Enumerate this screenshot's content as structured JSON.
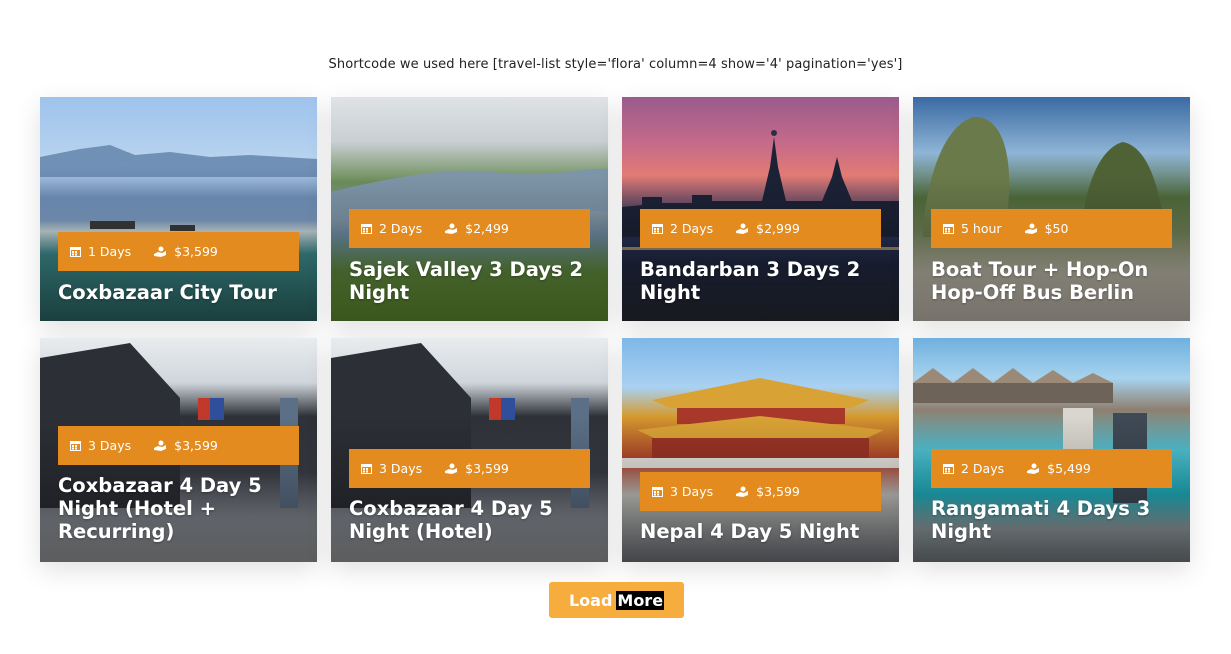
{
  "shortcode_text": "Shortcode we used here  [travel-list style='flora' column=4 show='4' pagination='yes']",
  "colors": {
    "meta_bar": "#e38b1e",
    "button": "#f6ad3e"
  },
  "icons": {
    "duration": "calendar-icon",
    "price": "hand-money-icon"
  },
  "tours": [
    {
      "duration": "1 Days",
      "price": "$3,599",
      "title": "Coxbazaar City Tour"
    },
    {
      "duration": "2 Days",
      "price": "$2,499",
      "title": "Sajek Valley 3 Days 2 Night"
    },
    {
      "duration": "2 Days",
      "price": "$2,999",
      "title": "Bandarban 3 Days 2 Night"
    },
    {
      "duration": "5 hour",
      "price": "$50",
      "title": "Boat Tour + Hop-On Hop-Off Bus Berlin"
    },
    {
      "duration": "3 Days",
      "price": "$3,599",
      "title": "Coxbazaar 4 Day 5 Night (Hotel + Recurring)"
    },
    {
      "duration": "3 Days",
      "price": "$3,599",
      "title": "Coxbazaar 4 Day 5 Night (Hotel)"
    },
    {
      "duration": "3 Days",
      "price": "$3,599",
      "title": "Nepal 4 Day 5 Night"
    },
    {
      "duration": "2 Days",
      "price": "$5,499",
      "title": "Rangamati 4 Days 3 Night"
    }
  ],
  "load_more": {
    "word1": "Load",
    "word2": "More"
  }
}
